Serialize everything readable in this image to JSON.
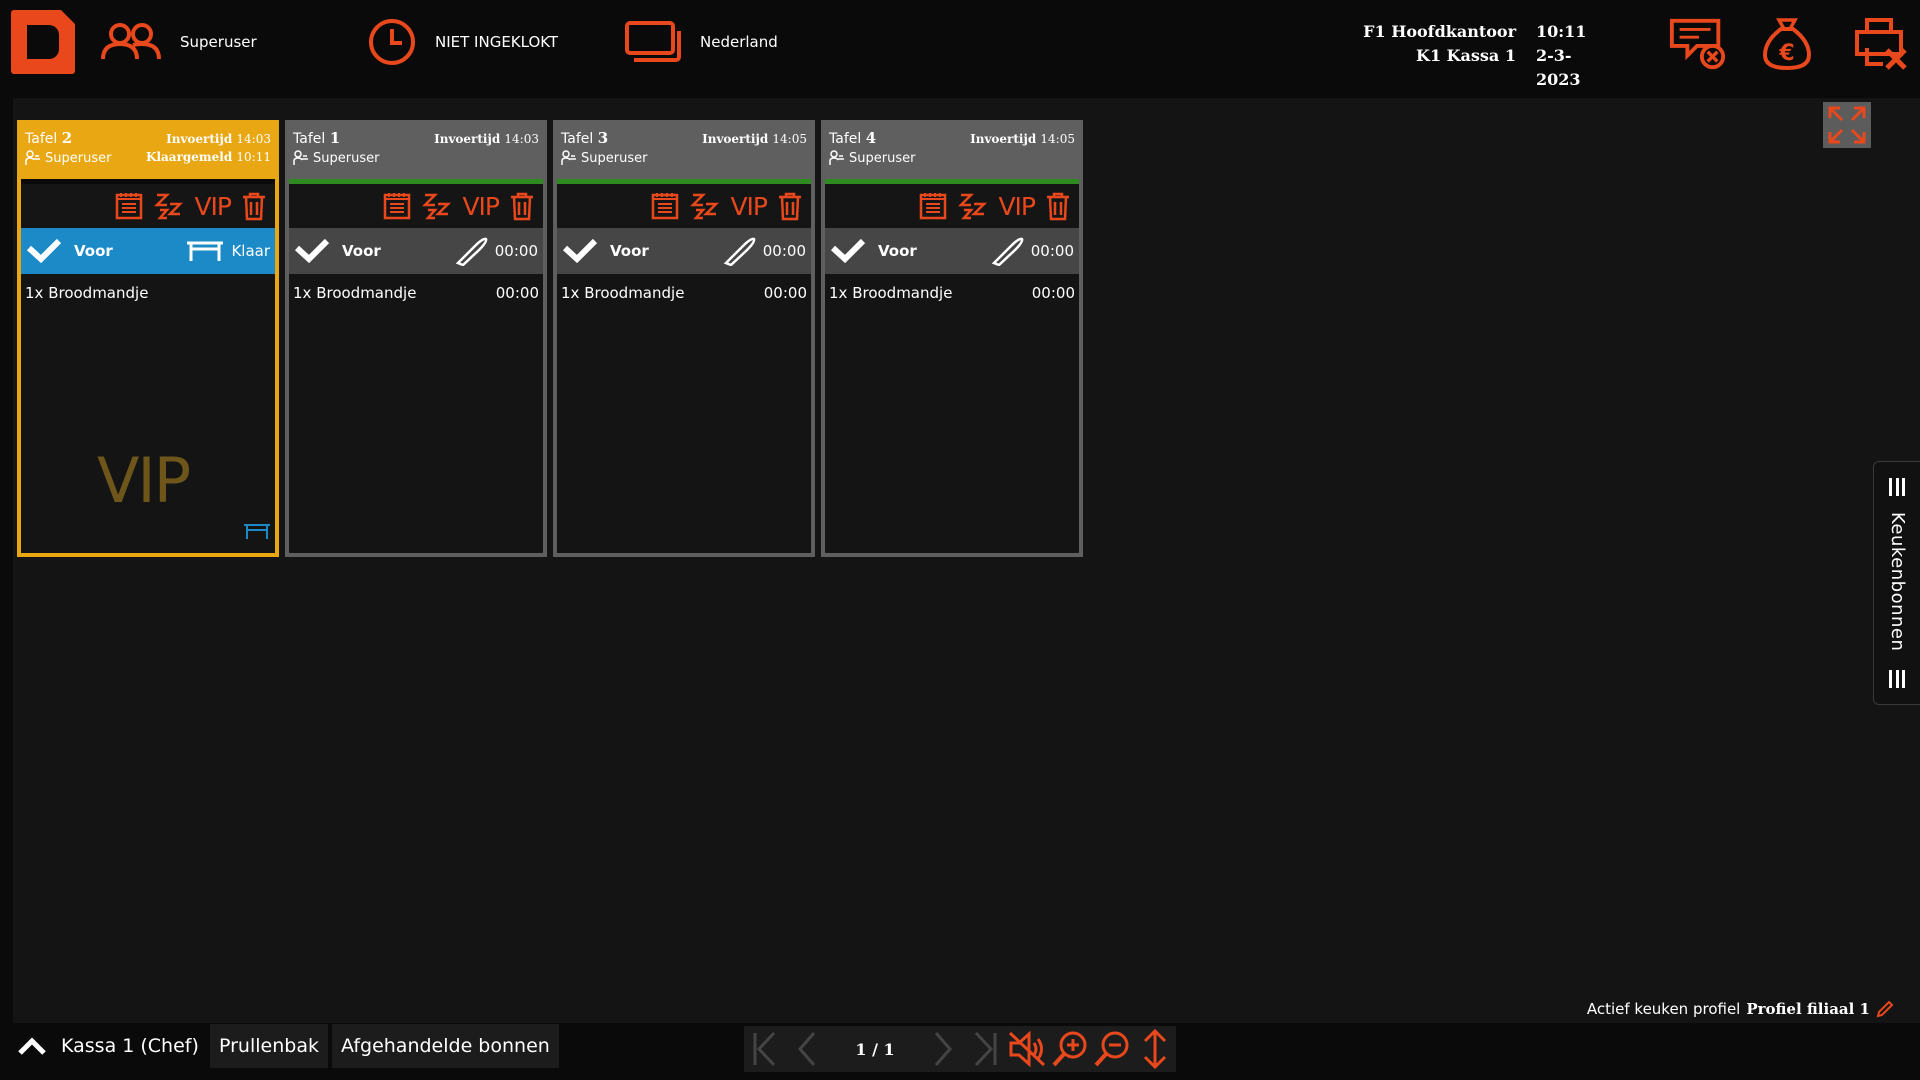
{
  "header": {
    "user": "Superuser",
    "clock_status": "NIET INGEKLOKT",
    "region": "Nederland",
    "branch": "F1 Hoofdkantoor",
    "time": "10:11",
    "register": "K1 Kassa 1",
    "date": "2-3-2023",
    "icons": [
      "users-icon",
      "clock-icon",
      "screens-icon",
      "message-cancel-icon",
      "money-bag-euro-icon",
      "printer-cancel-icon"
    ]
  },
  "tickets": [
    {
      "table_label": "Tafel",
      "table_number": "2",
      "entry_label": "Invoertijd",
      "entry_time": "14:03",
      "ready_label": "Klaargemeld",
      "ready_time": "10:11",
      "user": "Superuser",
      "vip": "VIP",
      "course": "Voor",
      "course_status": "Klaar",
      "item": "1x Broodmandje",
      "item_time": "",
      "watermark": "VIP",
      "active": true
    },
    {
      "table_label": "Tafel",
      "table_number": "1",
      "entry_label": "Invoertijd",
      "entry_time": "14:03",
      "user": "Superuser",
      "vip": "VIP",
      "course": "Voor",
      "course_status": "00:00",
      "item": "1x Broodmandje",
      "item_time": "00:00",
      "active": false
    },
    {
      "table_label": "Tafel",
      "table_number": "3",
      "entry_label": "Invoertijd",
      "entry_time": "14:05",
      "user": "Superuser",
      "vip": "VIP",
      "course": "Voor",
      "course_status": "00:00",
      "item": "1x Broodmandje",
      "item_time": "00:00",
      "active": false
    },
    {
      "table_label": "Tafel",
      "table_number": "4",
      "entry_label": "Invoertijd",
      "entry_time": "14:05",
      "user": "Superuser",
      "vip": "VIP",
      "course": "Voor",
      "course_status": "00:00",
      "item": "1x Broodmandje",
      "item_time": "00:00",
      "active": false
    }
  ],
  "sidetab": {
    "label": "Keukenbonnen"
  },
  "profile": {
    "label": "Actief keuken profiel",
    "name": "Profiel filiaal 1"
  },
  "footer": {
    "station": "Kassa 1 (Chef)",
    "trash": "Prullenbak",
    "done": "Afgehandelde bonnen",
    "page": "1 / 1"
  },
  "colors": {
    "accent": "#e8481c",
    "active_ticket": "#e9a813",
    "course_active": "#1b8ac6",
    "ticket": "#5f5f5f",
    "stripe": "#2e8b1f"
  }
}
